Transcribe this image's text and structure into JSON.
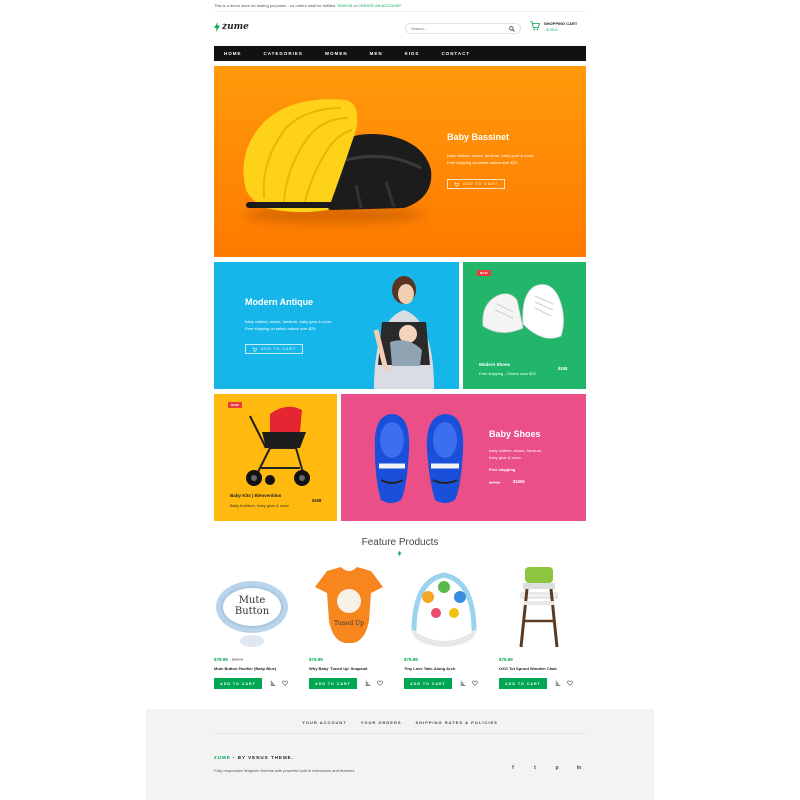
{
  "notice": {
    "text": "This is a demo store for testing purposes - no orders shall be fulfilled.",
    "sign_in": "SIGN IN",
    "or": "or",
    "create": "CREATE AN ACCOUNT"
  },
  "header": {
    "logo_text": "zume",
    "search_placeholder": "Search...",
    "cart_label": "SHOPPING CART",
    "cart_amount": "- $ 00.0"
  },
  "nav": {
    "items": [
      "HOME",
      "CATEGORIES",
      "WOMEN",
      "MEN",
      "KIDS",
      "CONTACT"
    ]
  },
  "hero": {
    "title": "Baby Bassinet",
    "desc1": "baby clothes, shoes, furniture, baby gear & more.",
    "desc2": "Free shipping on select orders over $25",
    "button": "ADD TO CART",
    "bg_color": "#ff8a00"
  },
  "tile_blue": {
    "title": "Modern Antique",
    "desc1": "baby clothes, shoes, furniture, baby gear & more.",
    "desc2": "Free shipping on select orders over $25",
    "button": "ADD TO CART"
  },
  "tile_green": {
    "badge": "NEW",
    "name": "Modern Shoes",
    "sub": "Free shipping - Orders over $25",
    "price": "$158"
  },
  "tile_yellow": {
    "badge": "NEW",
    "name": "Baby Kits | Bienvenidos",
    "sub": "Baby furniture, baby gear & more",
    "price": "$158"
  },
  "tile_pink": {
    "title": "Baby Shoes",
    "desc1": "baby clothes, shoes, furniture,",
    "desc2": "baby gear & more.",
    "shipping": "Free shipping",
    "old_price": "$8786",
    "price": "$1656"
  },
  "featured": {
    "title": "Feature Products",
    "products": [
      {
        "price": "$79.99",
        "old_price": "$99.0",
        "name": "Mute Button Pacifier (Baby Blue)",
        "button": "ADD TO CART",
        "image": "pacifier",
        "pacifier_text1": "Mute",
        "pacifier_text2": "Button"
      },
      {
        "price": "$79.99",
        "old_price": "",
        "name": "Why Baby 'Tuned Up' Snapsuit",
        "button": "ADD TO CART",
        "image": "onesie",
        "onesie_text": "Tuned Up"
      },
      {
        "price": "$79.99",
        "old_price": "",
        "name": "Tiny Love Take-Along Arch",
        "button": "ADD TO CART",
        "image": "baby-arch"
      },
      {
        "price": "$79.99",
        "old_price": "",
        "name": "OXO Tot Sprout Wooden Chair",
        "button": "ADD TO CART",
        "image": "high-chair"
      }
    ]
  },
  "footer": {
    "links": [
      "YOUR ACCOUNT",
      "YOUR ORDERS",
      "SHIPPING RATES & POLICIES"
    ],
    "brand": "ZUME",
    "brand_suffix": "- BY VENUS THEME.",
    "desc": "Fully responsive Magento themes with powerful built in extensions and features",
    "social": [
      "f",
      "t",
      "p",
      "in"
    ]
  },
  "colors": {
    "accent": "#00a651",
    "nav_bg": "#111111",
    "blue": "#16b6ea",
    "green": "#22b66a",
    "yellow": "#ffb90f",
    "pink": "#ea4f87"
  }
}
